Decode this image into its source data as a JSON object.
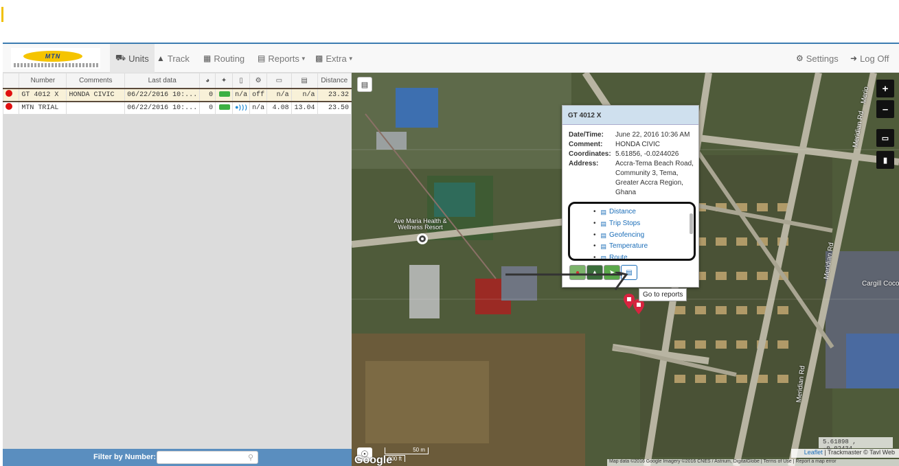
{
  "nav": {
    "logo_text": "MTN",
    "units": "Units",
    "track": "Track",
    "routing": "Routing",
    "reports": "Reports",
    "extra": "Extra",
    "settings": "Settings",
    "logoff": "Log Off"
  },
  "table": {
    "headers": {
      "number": "Number",
      "comments": "Comments",
      "last_data": "Last data",
      "distance": "Distance"
    },
    "rows": [
      {
        "number": "GT 4012 X",
        "comments": "HONDA CIVIC",
        "last_data": "06/22/2016 10:...",
        "speed": "0",
        "gsm": "n/a",
        "ignition": "off",
        "power": "n/a",
        "battery": "n/a",
        "distance": "23.32"
      },
      {
        "number": "MTN TRIAL",
        "comments": "",
        "last_data": "06/22/2016 10:...",
        "speed": "0",
        "gsm": "n/a",
        "ignition": "",
        "power": "4.08",
        "battery": "13.04",
        "distance": "23.50"
      }
    ]
  },
  "filter": {
    "label": "Filter by Number:",
    "value": "",
    "placeholder": ""
  },
  "popup": {
    "title": "GT 4012 X",
    "datetime_label": "Date/Time:",
    "datetime": "June 22, 2016 10:36 AM",
    "comment_label": "Comment:",
    "comment": "HONDA CIVIC",
    "coords_label": "Coordinates:",
    "coords": "5.61856, -0.0244026",
    "address_label": "Address:",
    "address": "Accra-Tema Beach Road, Community 3, Tema, Greater Accra Region, Ghana",
    "links": [
      "Distance",
      "Trip Stops",
      "Geofencing",
      "Temperature",
      "Route"
    ],
    "tooltip": "Go to reports"
  },
  "map": {
    "poi": "Ave Maria Health & Wellness Resort",
    "cargill": "Cargill Coco",
    "meridian": "Meridian Rd",
    "merio": "Merio",
    "coord_readout": "5.61898 , -0.02434",
    "attribution_link": "Leaflet",
    "attribution_text": "| Trackmaster © Tavl Web",
    "bottom_attribution": "Map data ©2016 Google Imagery ©2016 CNES / Astrium, DigitalGlobe | Terms of Use | Report a map error",
    "scale_m": "50 m",
    "scale_ft": "200 ft",
    "google": "Google"
  },
  "colors": {
    "accent": "#3b7bb0",
    "filter_bar": "#5a8ebf",
    "status_red": "#e01010",
    "link": "#1a6db8"
  }
}
